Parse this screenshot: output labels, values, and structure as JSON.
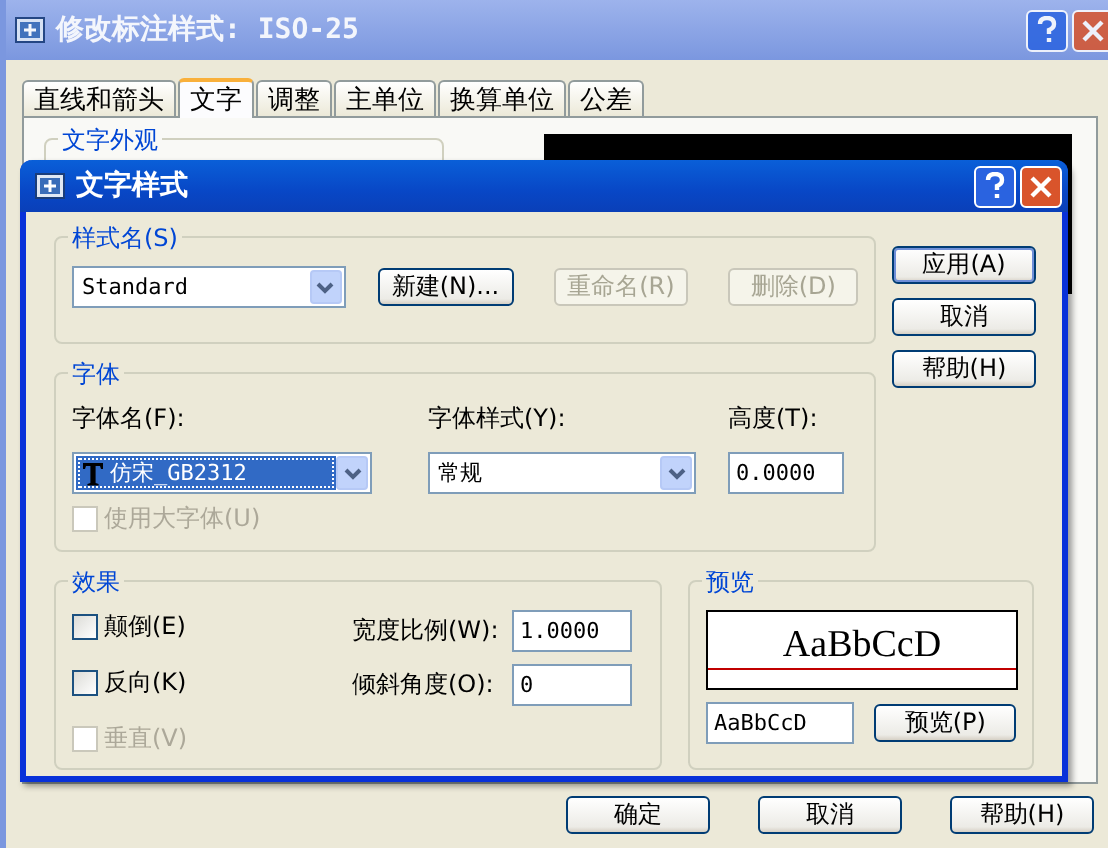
{
  "outer_window": {
    "title": "修改标注样式: ISO-25",
    "tabs": [
      {
        "label": "直线和箭头",
        "selected": false
      },
      {
        "label": "文字",
        "selected": true
      },
      {
        "label": "调整",
        "selected": false
      },
      {
        "label": "主单位",
        "selected": false
      },
      {
        "label": "换算单位",
        "selected": false
      },
      {
        "label": "公差",
        "selected": false
      }
    ],
    "group_label": "文字外观",
    "buttons": [
      "确定",
      "取消",
      "帮助(H)"
    ]
  },
  "dialog": {
    "title": "文字样式",
    "style_name": {
      "label": "样式名(S)",
      "value": "Standard",
      "buttons": [
        {
          "label": "新建(N)...",
          "disabled": false
        },
        {
          "label": "重命名(R)",
          "disabled": true
        },
        {
          "label": "删除(D)",
          "disabled": true
        }
      ]
    },
    "side_buttons": [
      {
        "label": "应用(A)",
        "default": true
      },
      {
        "label": "取消",
        "default": false
      },
      {
        "label": "帮助(H)",
        "default": false
      }
    ],
    "font": {
      "label": "字体",
      "font_name": {
        "label": "字体名(F):",
        "value": "仿宋_GB2312"
      },
      "font_style": {
        "label": "字体样式(Y):",
        "value": "常规"
      },
      "height": {
        "label": "高度(T):",
        "value": "0.0000"
      },
      "big_font": {
        "label": "使用大字体(U)",
        "checked": false,
        "disabled": true
      }
    },
    "effects": {
      "label": "效果",
      "checkboxes": [
        {
          "label": "颠倒(E)",
          "checked": false,
          "disabled": false
        },
        {
          "label": "反向(K)",
          "checked": false,
          "disabled": false
        },
        {
          "label": "垂直(V)",
          "checked": false,
          "disabled": true
        }
      ],
      "fields": [
        {
          "label": "宽度比例(W):",
          "value": "1.0000"
        },
        {
          "label": "倾斜角度(O):",
          "value": "0"
        }
      ]
    },
    "preview": {
      "label": "预览",
      "sample": "AaBbCcD",
      "input": "AaBbCcD",
      "button": "预览(P)"
    }
  }
}
